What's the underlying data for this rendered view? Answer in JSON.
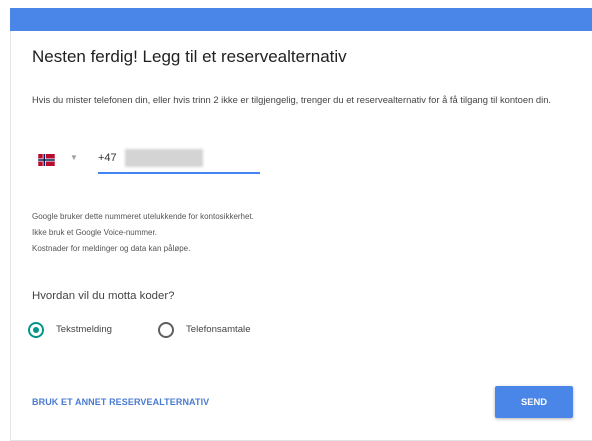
{
  "colors": {
    "top_bar": "#4a86e8",
    "accent": "#4285f4",
    "radio_selected": "#009688",
    "send_button": "#4a86e8",
    "link": "#4a7bd0"
  },
  "header": {
    "title": "Nesten ferdig! Legg til et reservealternativ"
  },
  "intro": {
    "text": "Hvis du mister telefonen din, eller hvis trinn 2 ikke er tilgjengelig, trenger du et reservealternativ for å få tilgang til kontoen din."
  },
  "phone": {
    "country_flag": "norway-flag-icon",
    "caret_icon": "caret-down-icon",
    "country_code": "+47"
  },
  "notes": [
    "Google bruker dette nummeret utelukkende for kontosikkerhet.",
    "Ikke bruk et Google Voice-nummer.",
    "Kostnader for meldinger og data kan påløpe."
  ],
  "method": {
    "question": "Hvordan vil du motta koder?",
    "options": [
      {
        "label": "Tekstmelding",
        "selected": true
      },
      {
        "label": "Telefonsamtale",
        "selected": false
      }
    ]
  },
  "actions": {
    "alternate_label": "BRUK ET ANNET RESERVEALTERNATIV",
    "send_label": "SEND"
  }
}
